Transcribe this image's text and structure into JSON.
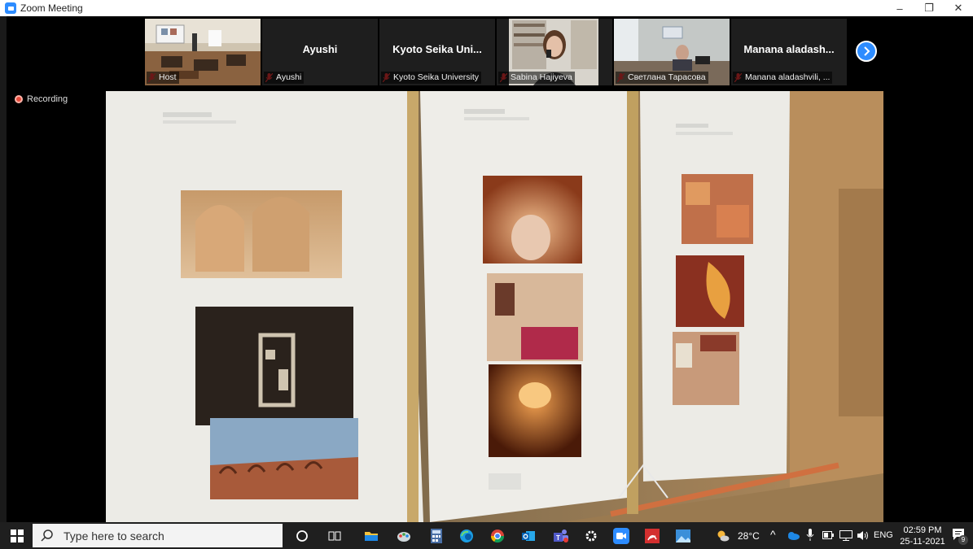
{
  "window": {
    "title": "Zoom Meeting",
    "minimize": "–",
    "restore": "❐",
    "close": "✕"
  },
  "participants": [
    {
      "label": "Host",
      "center_name": "",
      "video": true,
      "active": true
    },
    {
      "label": "Ayushi",
      "center_name": "Ayushi",
      "video": false,
      "active": false
    },
    {
      "label": "Kyoto Seika University",
      "center_name": "Kyoto Seika Uni...",
      "video": false,
      "active": false
    },
    {
      "label": "Sabina Hajiyeva",
      "center_name": "",
      "video": true,
      "active": false
    },
    {
      "label": "Светлана Тарасова",
      "center_name": "",
      "video": true,
      "active": false
    },
    {
      "label": "Manana aladashvili, ...",
      "center_name": "Manana aladash...",
      "video": false,
      "active": false
    }
  ],
  "recording": {
    "label": "Recording"
  },
  "taskbar": {
    "search_placeholder": "Type here to search",
    "weather": "28°C",
    "language": "ENG",
    "time": "02:59 PM",
    "date": "25-11-2021",
    "notification_count": "9",
    "pinned_apps": [
      "cortana-icon",
      "task-view-icon",
      "file-explorer-icon",
      "paint-icon",
      "calculator-icon",
      "edge-icon",
      "chrome-icon",
      "outlook-icon",
      "teams-icon",
      "settings-icon",
      "zoom-icon",
      "acrobat-icon",
      "photos-icon"
    ]
  },
  "colors": {
    "accent": "#2d8cff",
    "recording": "#e74c3c",
    "active_tile": "#c6d35c",
    "taskbar": "#1f1f1f"
  }
}
